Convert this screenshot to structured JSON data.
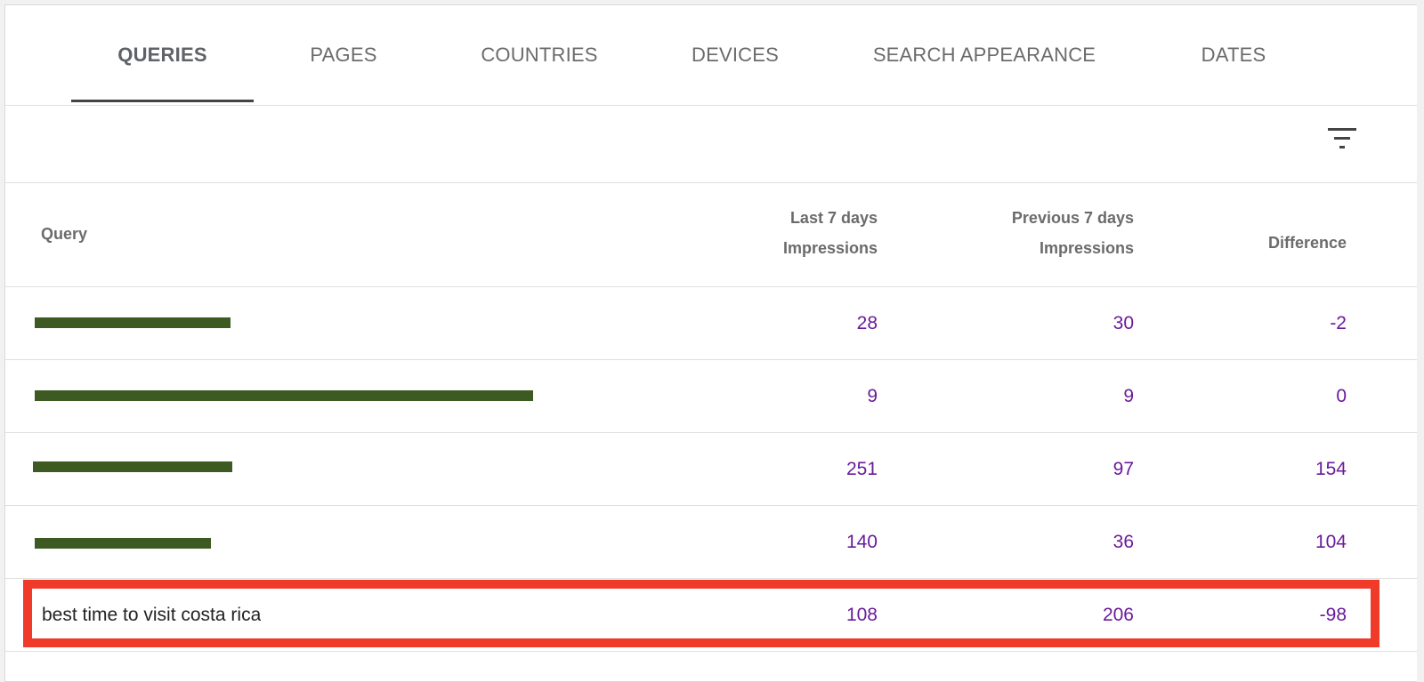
{
  "tabs": [
    {
      "label": "QUERIES",
      "active": true
    },
    {
      "label": "PAGES",
      "active": false
    },
    {
      "label": "COUNTRIES",
      "active": false
    },
    {
      "label": "DEVICES",
      "active": false
    },
    {
      "label": "SEARCH APPEARANCE",
      "active": false
    },
    {
      "label": "DATES",
      "active": false
    }
  ],
  "filter": {
    "icon": "filter-list-icon"
  },
  "table": {
    "headers": {
      "query": "Query",
      "last7_line1": "Last 7 days",
      "last7_line2": "Impressions",
      "prev7_line1": "Previous 7 days",
      "prev7_line2": "Impressions",
      "difference": "Difference"
    },
    "rows": [
      {
        "query": "",
        "last7": "28",
        "prev7": "30",
        "diff": "-2",
        "redacted": true
      },
      {
        "query": "",
        "last7": "9",
        "prev7": "9",
        "diff": "0",
        "redacted": true
      },
      {
        "query": "",
        "last7": "251",
        "prev7": "97",
        "diff": "154",
        "redacted": true
      },
      {
        "query": "",
        "last7": "140",
        "prev7": "36",
        "diff": "104",
        "redacted": true
      },
      {
        "query": "best time to visit costa rica",
        "last7": "108",
        "prev7": "206",
        "diff": "-98",
        "redacted": false,
        "highlighted": true
      }
    ]
  },
  "colors": {
    "value_text": "#6a1b9a",
    "highlight_border": "#f03a2a",
    "redaction_bar": "#3d5a22"
  }
}
